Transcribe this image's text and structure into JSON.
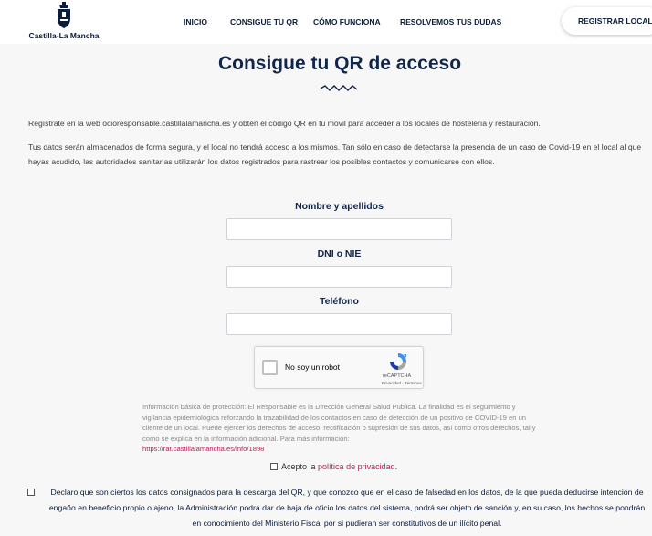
{
  "header": {
    "logo_text": "Castilla-La Mancha",
    "nav": [
      "INICIO",
      "CONSIGUE TU QR",
      "CÓMO FUNCIONA",
      "RESOLVEMOS TUS DUDAS"
    ],
    "register_label": "REGISTRAR LOCAL"
  },
  "page": {
    "title": "Consigue tu QR de acceso",
    "intro": "Regístrate en la web ocioresponsable.castillalamancha.es y obtén el código QR en tu móvil para acceder a los locales de hostelería y restauración.",
    "privacy_note": "Tus datos serán almacenados de forma segura, y el local no tendrá acceso a los mismos. Tan sólo en caso de detectarse la presencia de un caso de Covid-19 en el local al que hayas acudido, las autoridades sanitarias utilizarán los datos registrados para rastrear los posibles contactos y comunicarse con ellos."
  },
  "form": {
    "name_label": "Nombre y apellidos",
    "dni_label": "DNI o NIE",
    "phone_label": "Teléfono",
    "name_value": "",
    "dni_value": "",
    "phone_value": ""
  },
  "recaptcha": {
    "label": "No soy un robot",
    "brand": "reCAPTCHA",
    "terms": "Privacidad - Términos"
  },
  "info": {
    "text": "Información básica de protección: El Responsable es la Dirección General Salud Publica. La finalidad es el seguimiento y vigilancia epidemiológica reforzando la trazabilidad de los contactos en caso de detección de un positivo de COVID-19 en un cliente de un local. Puede ejercer los derechos de acceso, rectificación o supresión de sus datos, así como otros derechos, tal y como se explica en la información adicional. Para más información:",
    "link": "https://rat.castillalamancha.es/info/1898"
  },
  "consent": {
    "accept_prefix": "Acepto la",
    "accept_link": "política de privacidad",
    "accept_suffix": ".",
    "declaration": "Declaro que son ciertos los datos consignados para la descarga del QR, y que conozco que en el caso de falsedad en los datos, de la que pueda deducirse intención de engaño en beneficio propio o ajeno, la Administración podrá dar de baja de oficio los datos del sistema, podrá ser objeto de sanción y, en su caso, los hechos se pondrán en conocimiento del Ministerio Fiscal por si pudieran ser constitutivos de un ilícito penal."
  },
  "colors": {
    "navy": "#11264a",
    "link_pink": "#c2185b",
    "page_bg": "#f7f7f8"
  }
}
